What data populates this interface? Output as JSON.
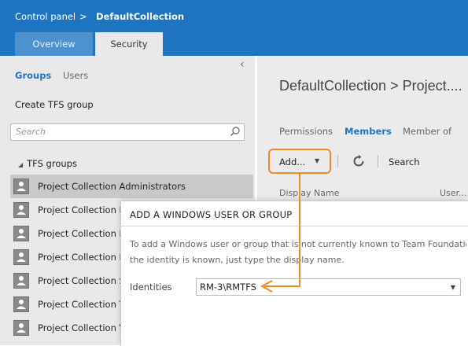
{
  "header": {
    "breadcrumb_root": "Control panel",
    "breadcrumb_sep": ">",
    "breadcrumb_current": "DefaultCollection",
    "tabs": [
      {
        "label": "Overview",
        "active": false
      },
      {
        "label": "Security",
        "active": true
      }
    ]
  },
  "left": {
    "collapse_glyph": "‹",
    "subtabs": [
      {
        "label": "Groups",
        "active": true
      },
      {
        "label": "Users",
        "active": false
      }
    ],
    "create_link": "Create TFS group",
    "search_placeholder": "Search",
    "tree_header": "TFS groups",
    "groups": [
      {
        "label": "Project Collection Administrators",
        "selected": true
      },
      {
        "label": "Project  Collection B",
        "selected": false
      },
      {
        "label": "Project Collection B",
        "selected": false
      },
      {
        "label": "Project Collection P",
        "selected": false
      },
      {
        "label": "Project Collection  S",
        "selected": false
      },
      {
        "label": "Project Collection T",
        "selected": false
      },
      {
        "label": "Project Collection V",
        "selected": false
      }
    ]
  },
  "right": {
    "title": "DefaultCollection > Project....",
    "pivots": [
      {
        "label": "Permissions",
        "active": false
      },
      {
        "label": "Members",
        "active": true
      },
      {
        "label": "Member of",
        "active": false
      }
    ],
    "toolbar": {
      "add_label": "Add...",
      "search_label": "Search"
    },
    "columns": [
      "Display Name",
      "User..."
    ]
  },
  "dialog": {
    "title": "ADD A WINDOWS USER OR GROUP",
    "description_line1": "To add a Windows user or group that is not currently known to Team Foundation....",
    "description_line2": "the identity is known, just type the display name.",
    "identities_label": "Identities",
    "identities_value": "RM-3\\RMTFS"
  },
  "colors": {
    "header_blue": "#1e74bf",
    "accent_orange": "#f08a24",
    "panel_gray": "#e9e9e9"
  },
  "icons": [
    "search-icon",
    "group-icon",
    "refresh-icon",
    "chevron-down-icon",
    "collapse-icon"
  ]
}
